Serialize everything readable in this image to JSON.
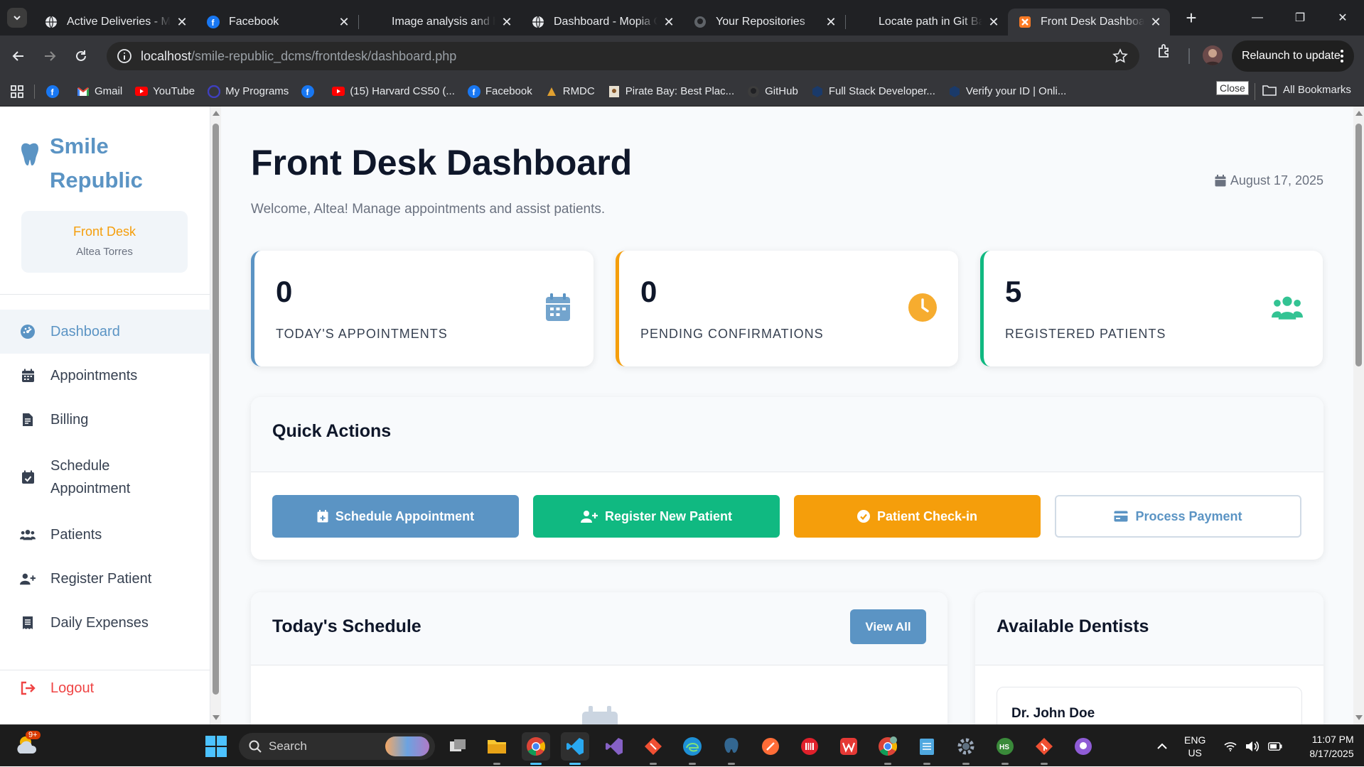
{
  "browser": {
    "tabs": [
      {
        "title": "Active Deliveries - Mo",
        "icon": "globe-icon"
      },
      {
        "title": "Facebook",
        "icon": "facebook-icon"
      },
      {
        "title": "Image analysis and h",
        "icon": "blank-icon"
      },
      {
        "title": "Dashboard - Mopia C",
        "icon": "globe-icon"
      },
      {
        "title": "Your Repositories",
        "icon": "github-icon"
      },
      {
        "title": "Locate path in Git Ba",
        "icon": "blank-icon"
      },
      {
        "title": "Front Desk Dashboar",
        "icon": "xampp-icon",
        "active": true
      }
    ],
    "url_host": "localhost",
    "url_path": "/smile-republic_dcms/frontdesk/dashboard.php",
    "relaunch_label": "Relaunch to update",
    "bookmarks": [
      {
        "label": "",
        "icon": "facebook-icon"
      },
      {
        "label": "Gmail",
        "icon": "gmail-icon"
      },
      {
        "label": "YouTube",
        "icon": "youtube-icon"
      },
      {
        "label": "My Programs",
        "icon": "programs-icon"
      },
      {
        "label": "",
        "icon": "facebook-icon"
      },
      {
        "label": "(15) Harvard CS50 (...",
        "icon": "youtube-icon"
      },
      {
        "label": "Facebook",
        "icon": "facebook-icon"
      },
      {
        "label": "RMDC",
        "icon": "rmdc-icon"
      },
      {
        "label": "Pirate Bay: Best Plac...",
        "icon": "piratebay-icon"
      },
      {
        "label": "GitHub",
        "icon": "github-icon"
      },
      {
        "label": "Full Stack Developer...",
        "icon": "fullstack-icon"
      },
      {
        "label": "Verify your ID | Onli...",
        "icon": "verify-icon"
      }
    ],
    "close_tooltip": "Close",
    "all_bookmarks_label": "All Bookmarks"
  },
  "sidebar": {
    "brand": "Smile Republic",
    "role": "Front Desk",
    "user": "Altea Torres",
    "items": [
      {
        "label": "Dashboard",
        "icon": "dashboard-icon",
        "active": true
      },
      {
        "label": "Appointments",
        "icon": "calendar-icon"
      },
      {
        "label": "Billing",
        "icon": "invoice-icon"
      },
      {
        "label": "Schedule Appointment",
        "icon": "calendar-check-icon"
      },
      {
        "label": "Patients",
        "icon": "users-icon"
      },
      {
        "label": "Register Patient",
        "icon": "user-plus-icon"
      },
      {
        "label": "Daily Expenses",
        "icon": "receipt-icon"
      }
    ],
    "logout": "Logout"
  },
  "main": {
    "title": "Front Desk Dashboard",
    "welcome": "Welcome, Altea! Manage appointments and assist patients.",
    "date": "August 17, 2025",
    "stats": [
      {
        "value": "0",
        "label": "TODAY'S APPOINTMENTS",
        "color": "#5b94c4",
        "icon": "calendar-icon"
      },
      {
        "value": "0",
        "label": "PENDING CONFIRMATIONS",
        "color": "#f59e0b",
        "icon": "clock-icon"
      },
      {
        "value": "5",
        "label": "REGISTERED PATIENTS",
        "color": "#10b981",
        "icon": "users-icon"
      }
    ],
    "quick_actions": {
      "title": "Quick Actions",
      "buttons": [
        {
          "label": "Schedule Appointment",
          "color": "#5b94c4",
          "icon": "calendar-plus-icon"
        },
        {
          "label": "Register New Patient",
          "color": "#10b981",
          "icon": "user-plus-icon"
        },
        {
          "label": "Patient Check-in",
          "color": "#f59e0b",
          "icon": "check-circle-icon"
        },
        {
          "label": "Process Payment",
          "color": "#5b94c4",
          "icon": "credit-card-icon"
        }
      ]
    },
    "schedule": {
      "title": "Today's Schedule",
      "view_all": "View All"
    },
    "dentists": {
      "title": "Available Dentists",
      "first": "Dr. John Doe"
    }
  },
  "taskbar": {
    "weather_badge": "9+",
    "search_placeholder": "Search",
    "lang": "ENG",
    "region": "US",
    "time": "11:07 PM",
    "date": "8/17/2025"
  }
}
